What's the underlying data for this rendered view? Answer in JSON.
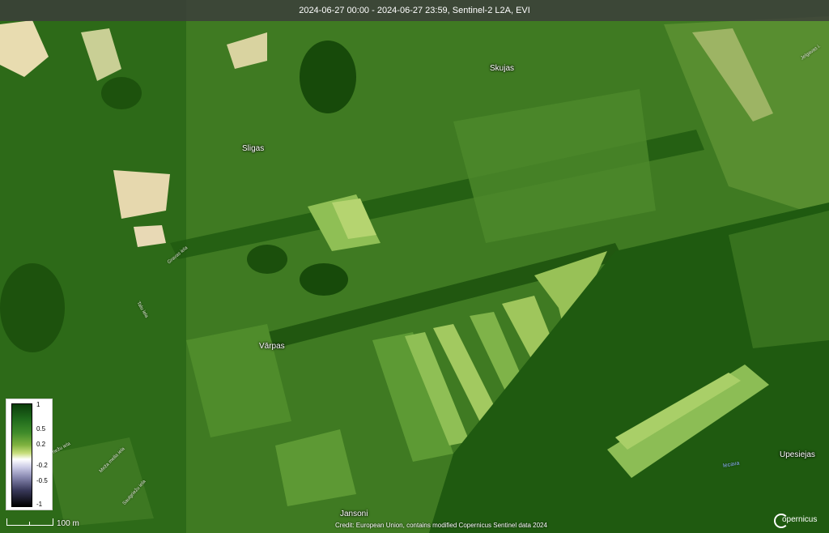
{
  "header": {
    "title": "2024-06-27 00:00 - 2024-06-27 23:59, Sentinel-2 L2A, EVI"
  },
  "places": [
    {
      "id": "skujas",
      "label": "Skujas"
    },
    {
      "id": "sligas",
      "label": "Sligas"
    },
    {
      "id": "varpas",
      "label": "Vārpas"
    },
    {
      "id": "upesiejas",
      "label": "Upesiejas"
    },
    {
      "id": "jansoni",
      "label": "Jansoni"
    }
  ],
  "roads": [
    {
      "id": "gravas",
      "label": "Gravas iela"
    },
    {
      "id": "talu",
      "label": "Talu iela"
    },
    {
      "id": "prieza",
      "label": "Priežu iela"
    },
    {
      "id": "meza",
      "label": "Meža mella iela"
    },
    {
      "id": "saulgrie",
      "label": "Saulgriežu iela"
    },
    {
      "id": "jelgavas",
      "label": "Jelgavas i."
    },
    {
      "id": "river",
      "label": "Iecava"
    }
  ],
  "legend": {
    "ticks": [
      "1",
      "0.5",
      "0.2",
      "-0.2",
      "-0.5",
      "-1"
    ]
  },
  "scale": {
    "label": "100 m"
  },
  "credit": {
    "text": "Credit: European Union, contains modified Copernicus Sentinel data 2024"
  },
  "logo": {
    "text": "opernicus"
  },
  "colors": {
    "dark_veg": "#1f5a10",
    "mid_veg": "#4d8a2c",
    "light_veg": "#8fbf55",
    "bare": "#e8dcb0"
  }
}
